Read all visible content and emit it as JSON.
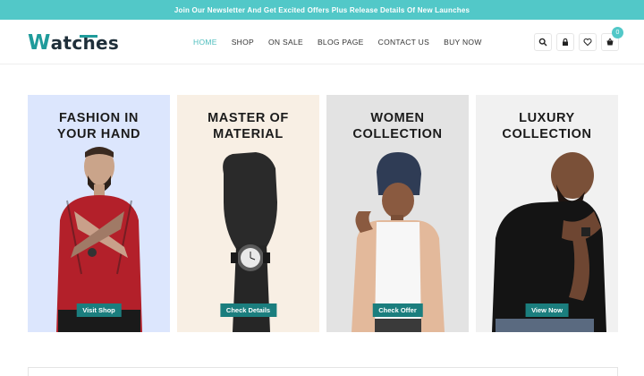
{
  "announcement": "Join Our Newsletter And Get Excited Offers Plus Release Details Of New Launches",
  "logo": {
    "text": "atches",
    "initial": "W"
  },
  "nav": [
    {
      "label": "HOME",
      "active": true
    },
    {
      "label": "SHOP",
      "active": false
    },
    {
      "label": "ON SALE",
      "active": false
    },
    {
      "label": "BLOG PAGE",
      "active": false
    },
    {
      "label": "CONTACT US",
      "active": false
    },
    {
      "label": "BUY NOW",
      "active": false
    }
  ],
  "header_icons": [
    "search-icon",
    "lock-icon",
    "heart-icon",
    "cart-icon"
  ],
  "cart_count": "0",
  "colors": {
    "accent": "#52c8c8",
    "button": "#1b7e7e",
    "brand": "#1f9b9b"
  },
  "panels": [
    {
      "title_line1": "FASHION IN",
      "title_line2": "YOUR HAND",
      "button": "Visit Shop",
      "bg": "#dce6fd"
    },
    {
      "title_line1": "MASTER OF",
      "title_line2": "MATERIAL",
      "button": "Check Details",
      "bg": "#f8efe4"
    },
    {
      "title_line1": "WOMEN",
      "title_line2": "COLLECTION",
      "button": "Check Offer",
      "bg": "#e3e3e3"
    },
    {
      "title_line1": "LUXURY",
      "title_line2": "COLLECTION",
      "button": "View Now",
      "bg": "#f1f1f1"
    }
  ]
}
